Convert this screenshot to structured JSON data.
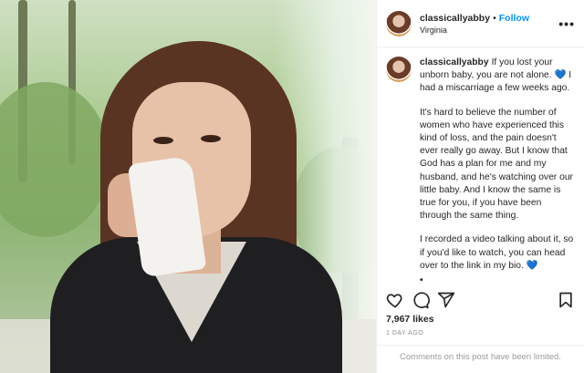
{
  "post": {
    "username": "classicallyabby",
    "follow_label": "Follow",
    "separator": "•",
    "location": "Virginia",
    "more_label": "•••",
    "caption": {
      "lead": "If you lost your unborn baby, you are not alone.",
      "heart": "💙",
      "lead_end": "I had a miscarriage a few weeks ago.",
      "paragraph2": "It's hard to believe the number of women who have experienced this kind of loss, and the pain doesn't ever really go away. But I know that God has a plan for me and my husband, and he's watching over our little baby. And I know the same is true for you, if you have been through the same thing.",
      "paragraph3": "I recorded a video talking about it, so if you'd like to watch, you can head over to the link in my bio.",
      "heart2": "💙",
      "dots": [
        "•",
        "•",
        "•"
      ]
    },
    "likes": "7,967 likes",
    "timestamp": "1 DAY AGO",
    "comments_status": "Comments on this post have been limited."
  },
  "icons": {
    "heart": "heart-icon",
    "comment": "comment-icon",
    "share": "share-icon",
    "save": "bookmark-icon"
  },
  "colors": {
    "follow": "#0095f6",
    "text": "#262626",
    "muted": "#8e8e8e"
  }
}
